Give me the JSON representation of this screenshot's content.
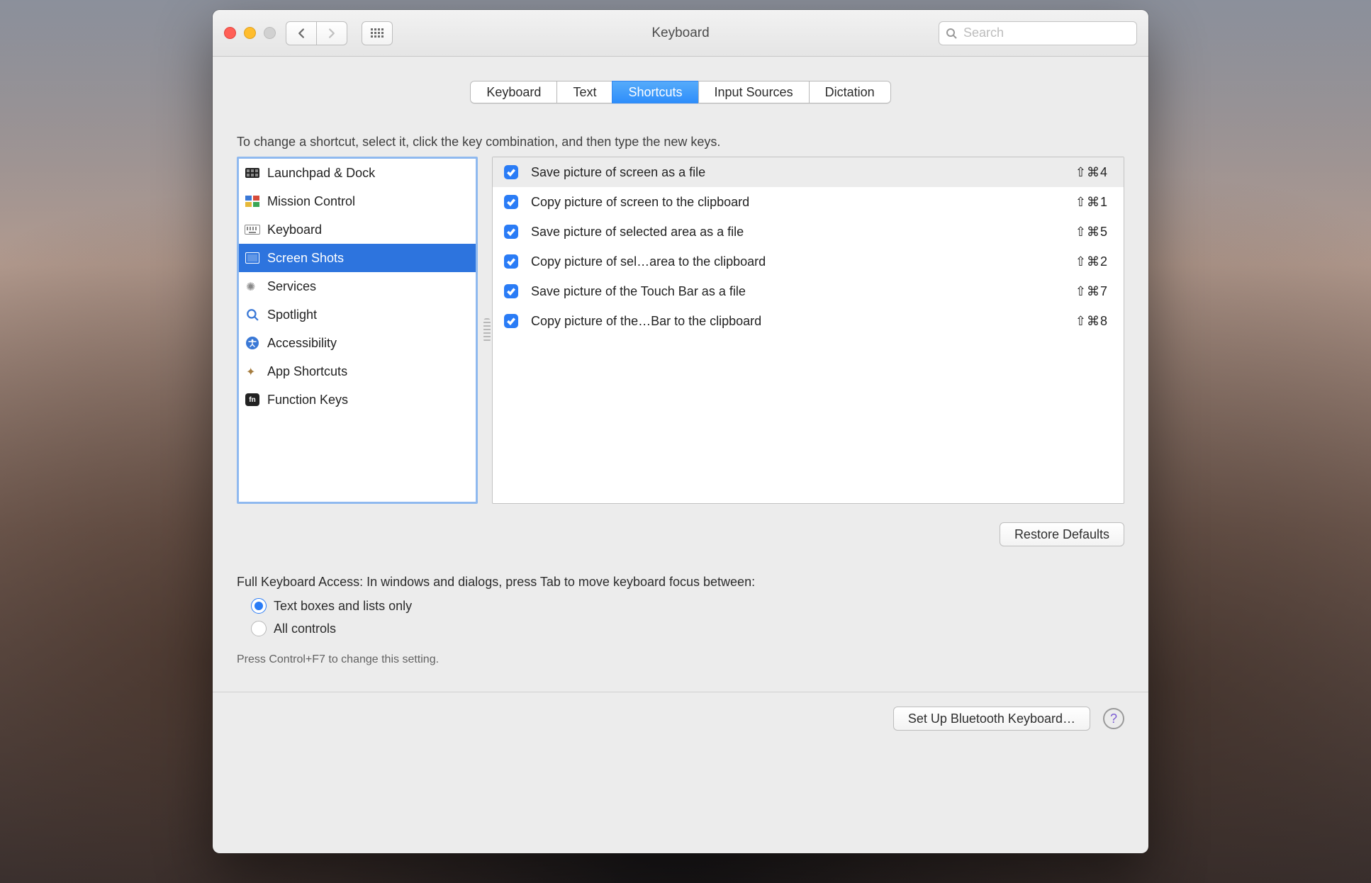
{
  "window": {
    "title": "Keyboard"
  },
  "search": {
    "placeholder": "Search"
  },
  "tabs": [
    {
      "label": "Keyboard",
      "selected": false
    },
    {
      "label": "Text",
      "selected": false
    },
    {
      "label": "Shortcuts",
      "selected": true
    },
    {
      "label": "Input Sources",
      "selected": false
    },
    {
      "label": "Dictation",
      "selected": false
    }
  ],
  "instruction": "To change a shortcut, select it, click the key combination, and then type the new keys.",
  "categories": [
    {
      "label": "Launchpad & Dock",
      "icon": "launchpad",
      "selected": false
    },
    {
      "label": "Mission Control",
      "icon": "mission",
      "selected": false
    },
    {
      "label": "Keyboard",
      "icon": "keyboard",
      "selected": false
    },
    {
      "label": "Screen Shots",
      "icon": "screenshots",
      "selected": true
    },
    {
      "label": "Services",
      "icon": "services",
      "selected": false
    },
    {
      "label": "Spotlight",
      "icon": "spotlight",
      "selected": false
    },
    {
      "label": "Accessibility",
      "icon": "accessibility",
      "selected": false
    },
    {
      "label": "App Shortcuts",
      "icon": "appshortcuts",
      "selected": false
    },
    {
      "label": "Function Keys",
      "icon": "fn",
      "selected": false
    }
  ],
  "shortcuts": [
    {
      "enabled": true,
      "label": "Save picture of screen as a file",
      "keys": "⇧⌘4",
      "selected": true
    },
    {
      "enabled": true,
      "label": "Copy picture of screen to the clipboard",
      "keys": "⇧⌘1",
      "selected": false
    },
    {
      "enabled": true,
      "label": "Save picture of selected area as a file",
      "keys": "⇧⌘5",
      "selected": false
    },
    {
      "enabled": true,
      "label": "Copy picture of sel…area to the clipboard",
      "keys": "⇧⌘2",
      "selected": false
    },
    {
      "enabled": true,
      "label": "Save picture of the Touch Bar as a file",
      "keys": "⇧⌘7",
      "selected": false
    },
    {
      "enabled": true,
      "label": "Copy picture of the…Bar to the clipboard",
      "keys": "⇧⌘8",
      "selected": false
    }
  ],
  "restore_label": "Restore Defaults",
  "fka": {
    "lead": "Full Keyboard Access: In windows and dialogs, press Tab to move keyboard focus between:",
    "options": [
      {
        "label": "Text boxes and lists only",
        "selected": true
      },
      {
        "label": "All controls",
        "selected": false
      }
    ],
    "hint": "Press Control+F7 to change this setting."
  },
  "footer": {
    "bluetooth": "Set Up Bluetooth Keyboard…"
  }
}
